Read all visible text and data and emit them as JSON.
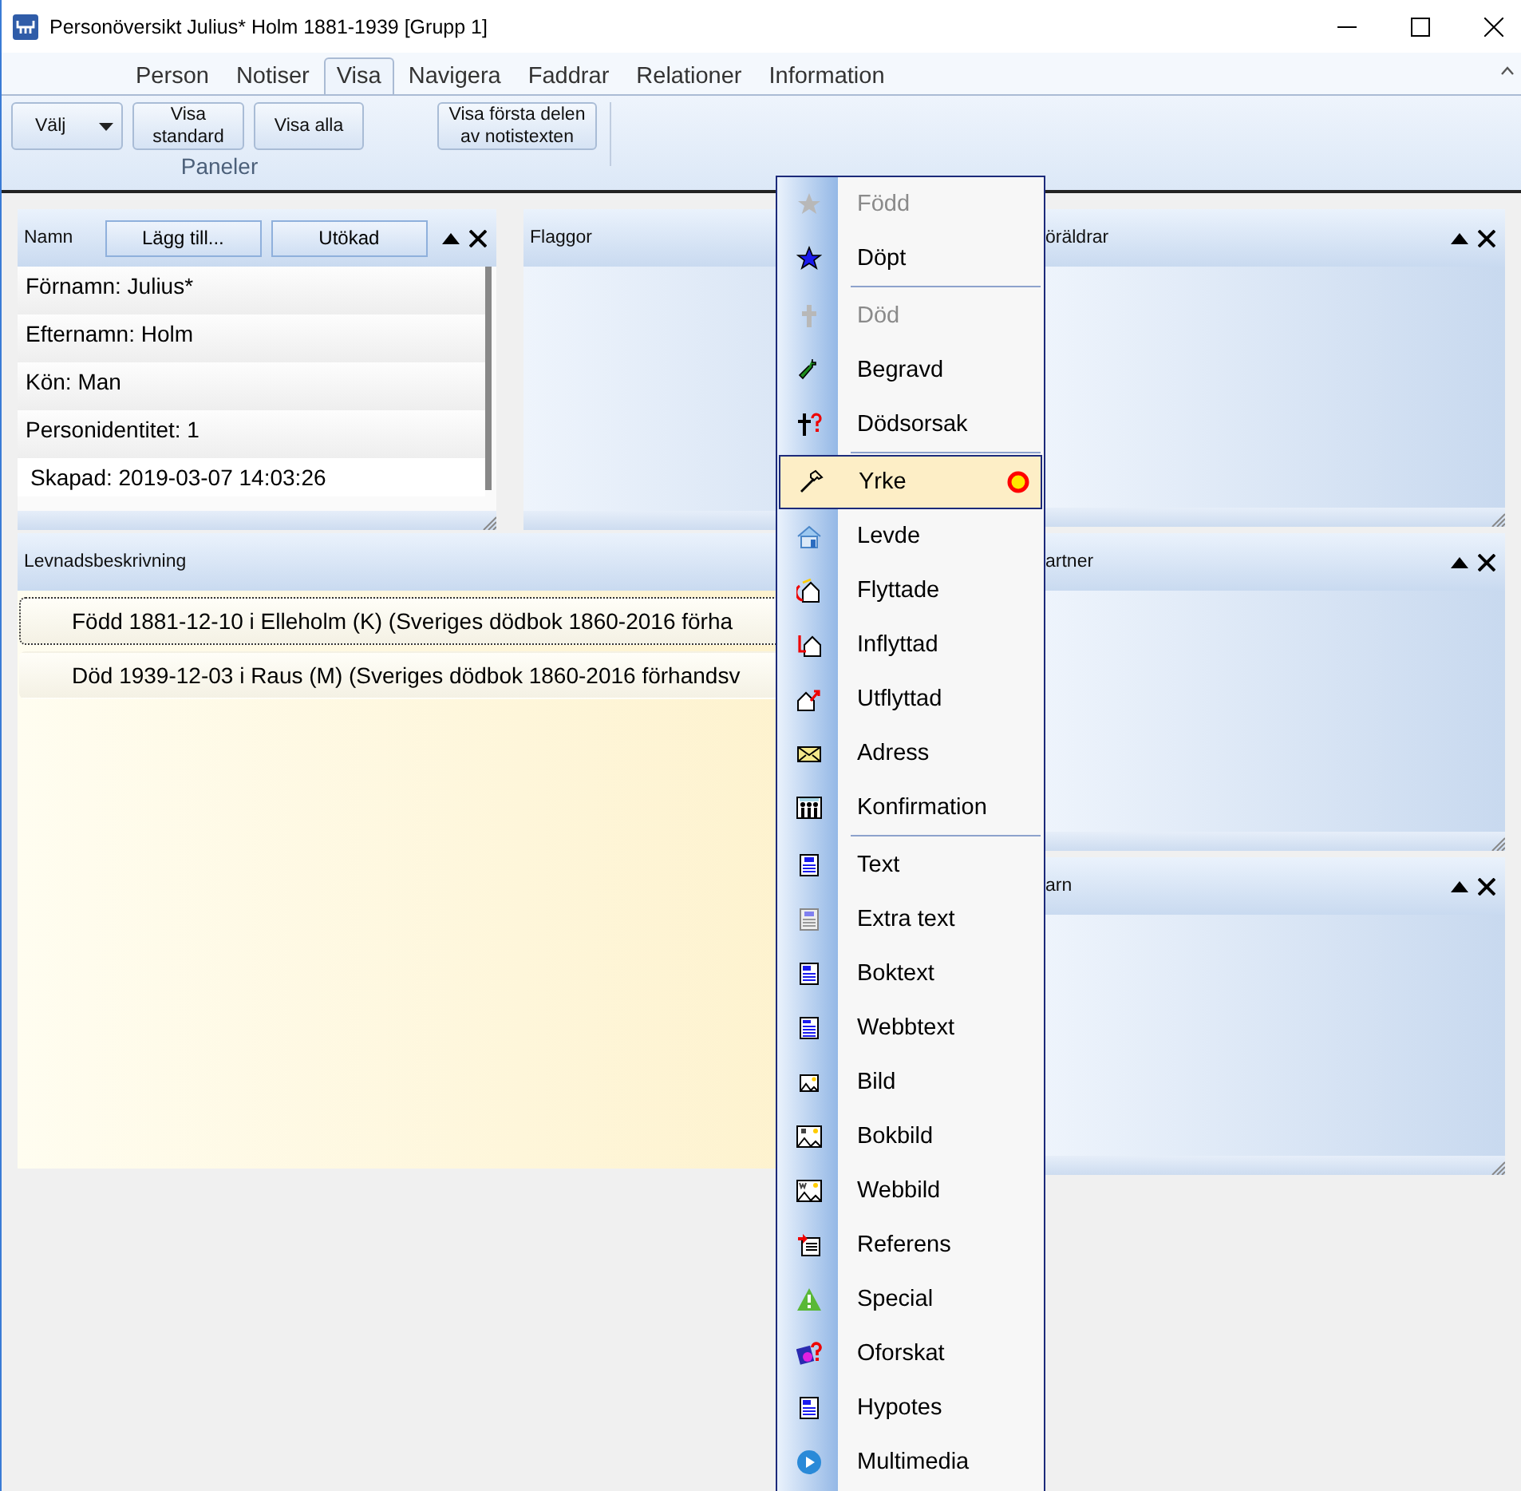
{
  "window": {
    "title": "Personöversikt Julius* Holm 1881-1939 [Grupp 1]"
  },
  "tabs": [
    {
      "label": "Person",
      "selected": false
    },
    {
      "label": "Notiser",
      "selected": false
    },
    {
      "label": "Visa",
      "selected": true
    },
    {
      "label": "Navigera",
      "selected": false
    },
    {
      "label": "Faddrar",
      "selected": false
    },
    {
      "label": "Relationer",
      "selected": false
    },
    {
      "label": "Information",
      "selected": false
    }
  ],
  "ribbon": {
    "groups": [
      {
        "label": "Paneler",
        "buttons": [
          {
            "label": "Välj",
            "kind": "dropdown"
          },
          {
            "label": "Visa standard",
            "kind": "plain"
          },
          {
            "label": "Visa alla",
            "kind": "plain"
          }
        ]
      },
      {
        "buttons": [
          {
            "label": "Visa första delen av notistexten",
            "kind": "plain"
          }
        ]
      }
    ]
  },
  "name_panel": {
    "title": "Namn",
    "buttons": [
      "Lägg till...",
      "Utökad"
    ],
    "rows": [
      "Förnamn: Julius*",
      "Efternamn: Holm",
      "Kön: Man",
      "Personidentitet: 1"
    ],
    "created": "Skapad:  2019-03-07   14:03:26"
  },
  "flags_panel": {
    "title": "Flaggor"
  },
  "life_panel": {
    "title": "Levnadsbeskrivning",
    "rows": [
      {
        "text": "Född 1881-12-10 i Elleholm (K) (Sveriges dödbok 1860-2016 förha",
        "selected": true
      },
      {
        "text": "Död 1939-12-03 i Raus (M) (Sveriges dödbok 1860-2016 förhandsv",
        "selected": false
      }
    ]
  },
  "side_panels": [
    {
      "title": "öräldrar"
    },
    {
      "title": "artner"
    },
    {
      "title": "arn"
    }
  ],
  "menu": {
    "items": [
      {
        "kind": "item",
        "label": "Född",
        "disabled": true,
        "selected": false,
        "marked": false
      },
      {
        "kind": "item",
        "label": "Döpt",
        "disabled": false,
        "selected": false,
        "marked": false
      },
      {
        "kind": "separator"
      },
      {
        "kind": "item",
        "label": "Död",
        "disabled": true,
        "selected": false,
        "marked": false
      },
      {
        "kind": "item",
        "label": "Begravd",
        "disabled": false,
        "selected": false,
        "marked": false
      },
      {
        "kind": "item",
        "label": "Dödsorsak",
        "disabled": false,
        "selected": false,
        "marked": false
      },
      {
        "kind": "separator"
      },
      {
        "kind": "item",
        "label": "Yrke",
        "disabled": false,
        "selected": true,
        "marked": true
      },
      {
        "kind": "item",
        "label": "Levde",
        "disabled": false,
        "selected": false,
        "marked": false
      },
      {
        "kind": "item",
        "label": "Flyttade",
        "disabled": false,
        "selected": false,
        "marked": false
      },
      {
        "kind": "item",
        "label": "Inflyttad",
        "disabled": false,
        "selected": false,
        "marked": false
      },
      {
        "kind": "item",
        "label": "Utflyttad",
        "disabled": false,
        "selected": false,
        "marked": false
      },
      {
        "kind": "item",
        "label": "Adress",
        "disabled": false,
        "selected": false,
        "marked": false
      },
      {
        "kind": "item",
        "label": "Konfirmation",
        "disabled": false,
        "selected": false,
        "marked": false
      },
      {
        "kind": "separator"
      },
      {
        "kind": "item",
        "label": "Text",
        "disabled": false,
        "selected": false,
        "marked": false
      },
      {
        "kind": "item",
        "label": "Extra text",
        "disabled": false,
        "selected": false,
        "marked": false
      },
      {
        "kind": "item",
        "label": "Boktext",
        "disabled": false,
        "selected": false,
        "marked": false
      },
      {
        "kind": "item",
        "label": "Webbtext",
        "disabled": false,
        "selected": false,
        "marked": false
      },
      {
        "kind": "item",
        "label": "Bild",
        "disabled": false,
        "selected": false,
        "marked": false
      },
      {
        "kind": "item",
        "label": "Bokbild",
        "disabled": false,
        "selected": false,
        "marked": false
      },
      {
        "kind": "item",
        "label": "Webbild",
        "disabled": false,
        "selected": false,
        "marked": false
      },
      {
        "kind": "item",
        "label": "Referens",
        "disabled": false,
        "selected": false,
        "marked": false
      },
      {
        "kind": "item",
        "label": "Special",
        "disabled": false,
        "selected": false,
        "marked": false
      },
      {
        "kind": "item",
        "label": "Oforskat",
        "disabled": false,
        "selected": false,
        "marked": false
      },
      {
        "kind": "item",
        "label": "Hypotes",
        "disabled": false,
        "selected": false,
        "marked": false
      },
      {
        "kind": "item",
        "label": "Multimedia",
        "disabled": false,
        "selected": false,
        "marked": false
      }
    ]
  }
}
